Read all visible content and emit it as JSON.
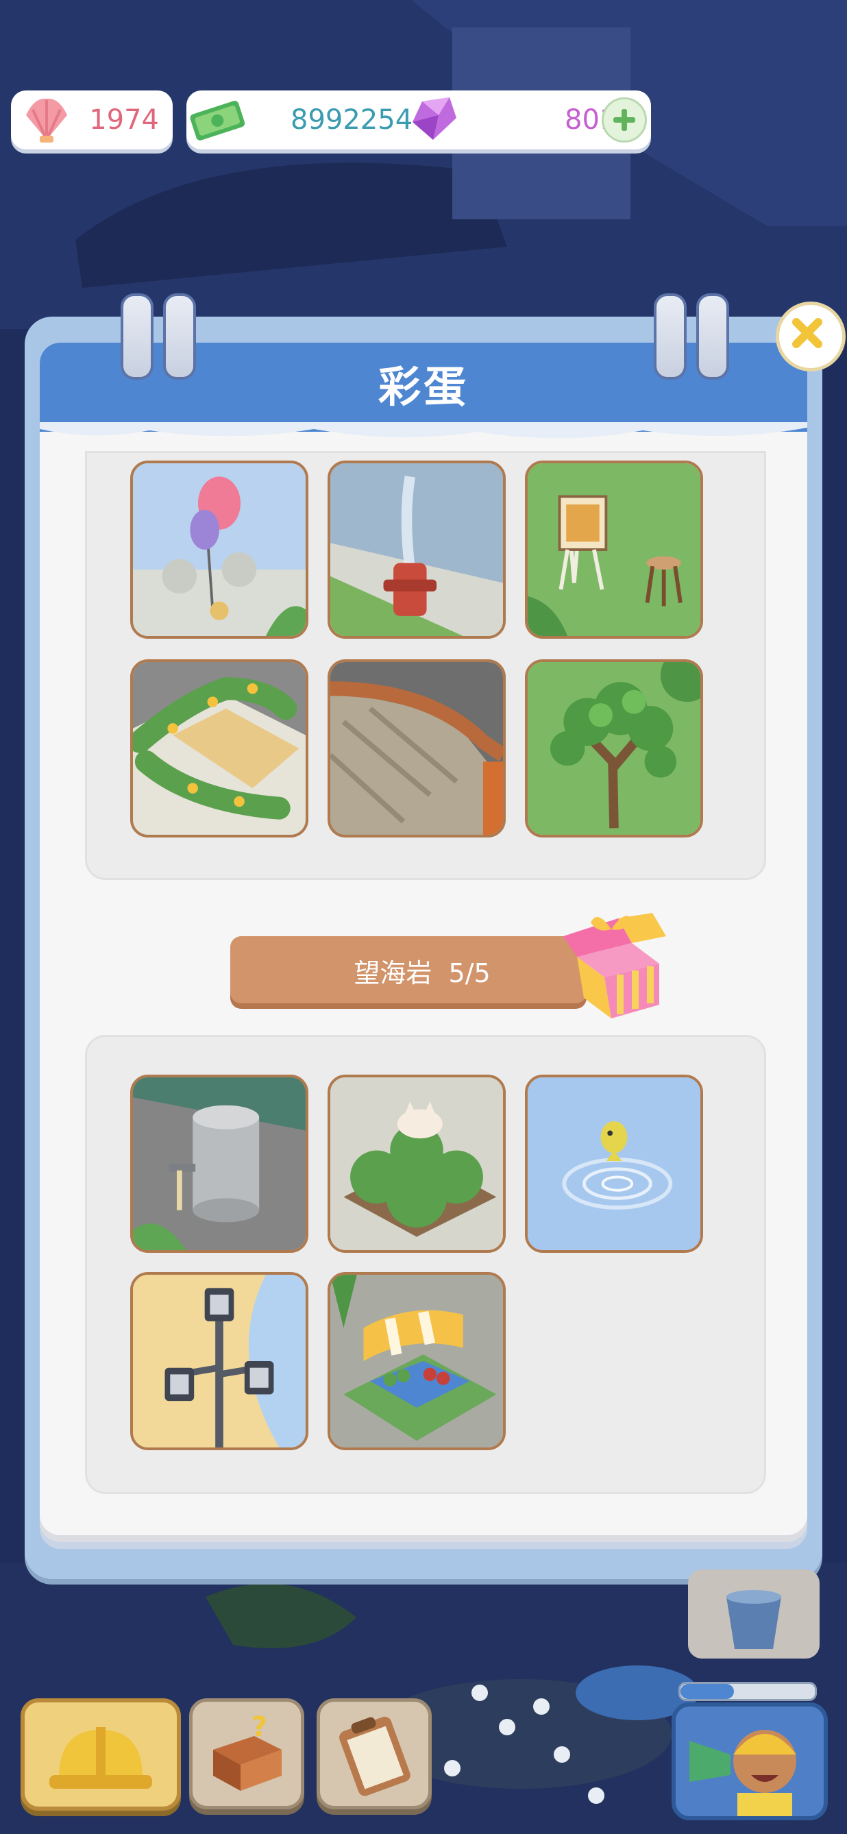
{
  "hud": {
    "shells": "1974",
    "money": "8992254",
    "gems": "801"
  },
  "dialog": {
    "title": "彩蛋",
    "section_label": "望海岩",
    "section_progress": "5/5"
  },
  "icons": {
    "shell": "shell-icon",
    "money": "banknote-icon",
    "gem": "gem-icon",
    "plus": "plus-icon",
    "close": "close-icon",
    "gift": "gift-box-icon",
    "hard_hat": "hard-hat-icon",
    "toolbox": "toolbox-icon",
    "clipboard": "clipboard-icon",
    "bucket": "bucket-icon",
    "avatar": "character-avatar"
  },
  "colors": {
    "header": "#4f86d1",
    "shell_text": "#e0677b",
    "money_text": "#3b9bb0",
    "gem_text": "#c65fd0",
    "section_bar": "#d2946b",
    "tile_border": "#b07a4f"
  }
}
